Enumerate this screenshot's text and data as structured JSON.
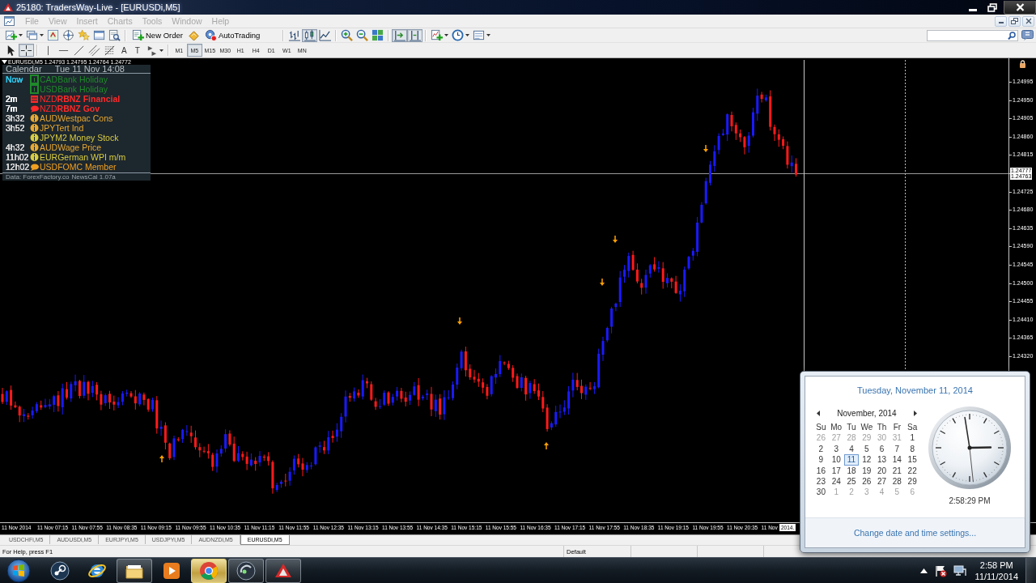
{
  "window": {
    "title": "25180: TradersWay-Live - [EURUSDi,M5]"
  },
  "menu": {
    "items": [
      {
        "label": "File",
        "disabled": true
      },
      {
        "label": "View",
        "disabled": true
      },
      {
        "label": "Insert",
        "disabled": true
      },
      {
        "label": "Charts",
        "disabled": true
      },
      {
        "label": "Tools",
        "disabled": true
      },
      {
        "label": "Window",
        "disabled": true
      },
      {
        "label": "Help",
        "disabled": true
      }
    ]
  },
  "toolbar": {
    "groups": [
      [
        {
          "kind": "new-chart",
          "pressed": false
        },
        {
          "kind": "profiles",
          "pressed": false
        },
        {
          "kind": "market-watch",
          "pressed": false
        },
        {
          "kind": "navigator",
          "pressed": false
        },
        {
          "kind": "favorites",
          "pressed": false
        },
        {
          "kind": "terminal",
          "pressed": false
        },
        {
          "kind": "tester",
          "pressed": false
        }
      ],
      [
        {
          "kind": "new-order",
          "label": "New Order",
          "pressed": false
        },
        {
          "kind": "editor",
          "pressed": false
        },
        {
          "kind": "autotrading",
          "label": "AutoTrading",
          "pressed": false
        }
      ],
      [
        {
          "kind": "bar-chart",
          "pressed": false
        },
        {
          "kind": "candle-chart",
          "pressed": true
        },
        {
          "kind": "line-chart",
          "pressed": false
        }
      ],
      [
        {
          "kind": "zoom-in",
          "pressed": false
        },
        {
          "kind": "zoom-out",
          "pressed": false
        },
        {
          "kind": "tile",
          "pressed": false
        }
      ],
      [
        {
          "kind": "auto-scroll",
          "pressed": true
        },
        {
          "kind": "chart-shift",
          "pressed": true
        }
      ],
      [
        {
          "kind": "indicators",
          "pressed": false
        },
        {
          "kind": "periods",
          "pressed": false
        },
        {
          "kind": "templates",
          "pressed": false
        }
      ]
    ]
  },
  "drawing_tools": [
    [
      {
        "kind": "cursor",
        "pressed": false
      },
      {
        "kind": "crosshair",
        "pressed": true
      }
    ],
    [
      {
        "kind": "vline",
        "pressed": false
      },
      {
        "kind": "hline",
        "pressed": false
      },
      {
        "kind": "trendline",
        "pressed": false
      },
      {
        "kind": "channel",
        "pressed": false
      },
      {
        "kind": "fibonacci",
        "pressed": false
      },
      {
        "kind": "text",
        "glyph": "A",
        "pressed": false
      },
      {
        "kind": "label",
        "glyph": "T",
        "pressed": false
      },
      {
        "kind": "arrows",
        "pressed": false
      }
    ]
  ],
  "timeframes": [
    {
      "label": "M1",
      "selected": false
    },
    {
      "label": "M5",
      "selected": true
    },
    {
      "label": "M15",
      "selected": false
    },
    {
      "label": "M30",
      "selected": false
    },
    {
      "label": "H1",
      "selected": false
    },
    {
      "label": "H4",
      "selected": false
    },
    {
      "label": "D1",
      "selected": false
    },
    {
      "label": "W1",
      "selected": false
    },
    {
      "label": "MN",
      "selected": false
    }
  ],
  "chart": {
    "header": "EURUSDi,M5  1.24793 1.24795 1.24764 1.24772",
    "price_axis": [
      {
        "kind": "tick",
        "label": "1.24995"
      },
      {
        "kind": "tick",
        "label": "1.24950"
      },
      {
        "kind": "tick",
        "label": "1.24905"
      },
      {
        "kind": "tick",
        "label": "1.24860"
      },
      {
        "kind": "tick",
        "label": "1.24815"
      },
      {
        "kind": "bid",
        "labels": [
          "1.24777",
          "1.24763"
        ]
      },
      {
        "kind": "tick",
        "label": "1.24725"
      },
      {
        "kind": "tick",
        "label": "1.24680"
      },
      {
        "kind": "tick",
        "label": "1.24635"
      },
      {
        "kind": "tick",
        "label": "1.24590"
      },
      {
        "kind": "tick",
        "label": "1.24545"
      },
      {
        "kind": "tick",
        "label": "1.24500"
      },
      {
        "kind": "tick",
        "label": "1.24455"
      },
      {
        "kind": "tick",
        "label": "1.24410"
      },
      {
        "kind": "tick",
        "label": "1.24365"
      },
      {
        "kind": "tick",
        "label": "1.24320"
      }
    ],
    "time_axis": [
      "11 Nov 2014",
      "11 Nov 07:15",
      "11 Nov 07:55",
      "11 Nov 08:35",
      "11 Nov 09:15",
      "11 Nov 09:55",
      "11 Nov 10:35",
      "11 Nov 11:15",
      "11 Nov 11:55",
      "11 Nov 12:35",
      "11 Nov 13:15",
      "11 Nov 13:55",
      "11 Nov 14:35",
      "11 Nov 15:15",
      "11 Nov 15:55",
      "11 Nov 16:35",
      "11 Nov 17:15",
      "11 Nov 17:55",
      "11 Nov 18:35",
      "11 Nov 19:15",
      "11 Nov 19:55",
      "11 Nov 20:35",
      "11 Nov"
    ],
    "cursor_time": "2014."
  },
  "news": {
    "title": "Calendar",
    "date": "Tue 11 Nov 14:08",
    "events": [
      {
        "time": {
          "label": "Now",
          "color": "#2ec4e8"
        },
        "kind": "box",
        "currency": "CAD",
        "title": "Bank Holiday",
        "color": "#1f8a2a",
        "bold": false
      },
      {
        "kind": "box",
        "currency": "USD",
        "title": "Bank Holiday",
        "color": "#1f8a2a",
        "bold": false
      },
      {
        "time": {
          "label": "2m",
          "color": "#ffffff"
        },
        "kind": "folder",
        "currency": "NZD",
        "title": "RBNZ Financial",
        "color": "#ff2a2a",
        "bold": true
      },
      {
        "time": {
          "label": "7m",
          "color": "#ffffff"
        },
        "kind": "speech",
        "currency": "NZD",
        "title": "RBNZ Gov",
        "color": "#ff2a2a",
        "bold": true
      },
      {
        "time": {
          "label": "3h32",
          "color": "#d6d6d6"
        },
        "kind": "info",
        "currency": "AUD",
        "title": "Westpac Cons",
        "color": "#e8a830",
        "bold": false
      },
      {
        "time": {
          "label": "3h52",
          "color": "#d6d6d6"
        },
        "kind": "info",
        "currency": "JPY",
        "title": "Tert Ind",
        "color": "#e8a830",
        "bold": false
      },
      {
        "kind": "info",
        "currency": "JPY",
        "title": "M2 Money Stock",
        "color": "#d8cc40",
        "bold": false
      },
      {
        "time": {
          "label": "4h32",
          "color": "#d6d6d6"
        },
        "kind": "info",
        "currency": "AUD",
        "title": "Wage Price",
        "color": "#e8a830",
        "bold": false
      },
      {
        "time": {
          "label": "11h02",
          "color": "#d6d6d6"
        },
        "kind": "info",
        "currency": "EUR",
        "title": "German WPI m/m",
        "color": "#d8cc40",
        "bold": false
      },
      {
        "time": {
          "label": "12h02",
          "color": "#d6d6d6"
        },
        "kind": "speech",
        "currency": "USD",
        "title": "FOMC Member",
        "color": "#f0a020",
        "bold": false
      }
    ],
    "source": "Data: ForexFactory.co",
    "version": "NewsCal 1.07a"
  },
  "tabs": [
    {
      "label": "USDCHFi,M5",
      "selected": false
    },
    {
      "label": "AUDUSDi,M5",
      "selected": false
    },
    {
      "label": "EURJPYi,M5",
      "selected": false
    },
    {
      "label": "USDJPYi,M5",
      "selected": false
    },
    {
      "label": "AUDNZDi,M5",
      "selected": false
    },
    {
      "label": "EURUSDi,M5",
      "selected": true
    }
  ],
  "status_bar": {
    "help": "For Help, press F1",
    "profile": "Default"
  },
  "taskbar": {
    "apps": [
      {
        "kind": "disc",
        "running": false,
        "highlighted": false
      },
      {
        "kind": "globe",
        "running": false,
        "highlighted": false
      },
      {
        "kind": "folder",
        "running": true,
        "highlighted": false
      },
      {
        "kind": "player",
        "running": false,
        "highlighted": false
      },
      {
        "kind": "segmented",
        "running": true,
        "highlighted": true
      },
      {
        "kind": "headset",
        "running": true,
        "highlighted": false
      },
      {
        "kind": "triangle",
        "running": true,
        "highlighted": false
      }
    ],
    "time": "2:58 PM",
    "date": "11/11/2014"
  },
  "clock_flyout": {
    "date_link": "Tuesday, November 11, 2014",
    "month": "November, 2014",
    "weekdays": [
      "Su",
      "Mo",
      "Tu",
      "We",
      "Th",
      "Fr",
      "Sa"
    ],
    "weeks": [
      [
        {
          "day": "26",
          "in_month": false,
          "selected": false
        },
        {
          "day": "27",
          "in_month": false,
          "selected": false
        },
        {
          "day": "28",
          "in_month": false,
          "selected": false
        },
        {
          "day": "29",
          "in_month": false,
          "selected": false
        },
        {
          "day": "30",
          "in_month": false,
          "selected": false
        },
        {
          "day": "31",
          "in_month": false,
          "selected": false
        },
        {
          "day": "1",
          "in_month": true,
          "selected": false
        }
      ],
      [
        {
          "day": "2",
          "in_month": true,
          "selected": false
        },
        {
          "day": "3",
          "in_month": true,
          "selected": false
        },
        {
          "day": "4",
          "in_month": true,
          "selected": false
        },
        {
          "day": "5",
          "in_month": true,
          "selected": false
        },
        {
          "day": "6",
          "in_month": true,
          "selected": false
        },
        {
          "day": "7",
          "in_month": true,
          "selected": false
        },
        {
          "day": "8",
          "in_month": true,
          "selected": false
        }
      ],
      [
        {
          "day": "9",
          "in_month": true,
          "selected": false
        },
        {
          "day": "10",
          "in_month": true,
          "selected": false
        },
        {
          "day": "11",
          "in_month": true,
          "selected": true
        },
        {
          "day": "12",
          "in_month": true,
          "selected": false
        },
        {
          "day": "13",
          "in_month": true,
          "selected": false
        },
        {
          "day": "14",
          "in_month": true,
          "selected": false
        },
        {
          "day": "15",
          "in_month": true,
          "selected": false
        }
      ],
      [
        {
          "day": "16",
          "in_month": true,
          "selected": false
        },
        {
          "day": "17",
          "in_month": true,
          "selected": false
        },
        {
          "day": "18",
          "in_month": true,
          "selected": false
        },
        {
          "day": "19",
          "in_month": true,
          "selected": false
        },
        {
          "day": "20",
          "in_month": true,
          "selected": false
        },
        {
          "day": "21",
          "in_month": true,
          "selected": false
        },
        {
          "day": "22",
          "in_month": true,
          "selected": false
        }
      ],
      [
        {
          "day": "23",
          "in_month": true,
          "selected": false
        },
        {
          "day": "24",
          "in_month": true,
          "selected": false
        },
        {
          "day": "25",
          "in_month": true,
          "selected": false
        },
        {
          "day": "26",
          "in_month": true,
          "selected": false
        },
        {
          "day": "27",
          "in_month": true,
          "selected": false
        },
        {
          "day": "28",
          "in_month": true,
          "selected": false
        },
        {
          "day": "29",
          "in_month": true,
          "selected": false
        }
      ],
      [
        {
          "day": "30",
          "in_month": true,
          "selected": false
        },
        {
          "day": "1",
          "in_month": false,
          "selected": false
        },
        {
          "day": "2",
          "in_month": false,
          "selected": false
        },
        {
          "day": "3",
          "in_month": false,
          "selected": false
        },
        {
          "day": "4",
          "in_month": false,
          "selected": false
        },
        {
          "day": "5",
          "in_month": false,
          "selected": false
        },
        {
          "day": "6",
          "in_month": false,
          "selected": false
        }
      ]
    ],
    "time": "2:58:29 PM",
    "settings_link": "Change date and time settings..."
  }
}
